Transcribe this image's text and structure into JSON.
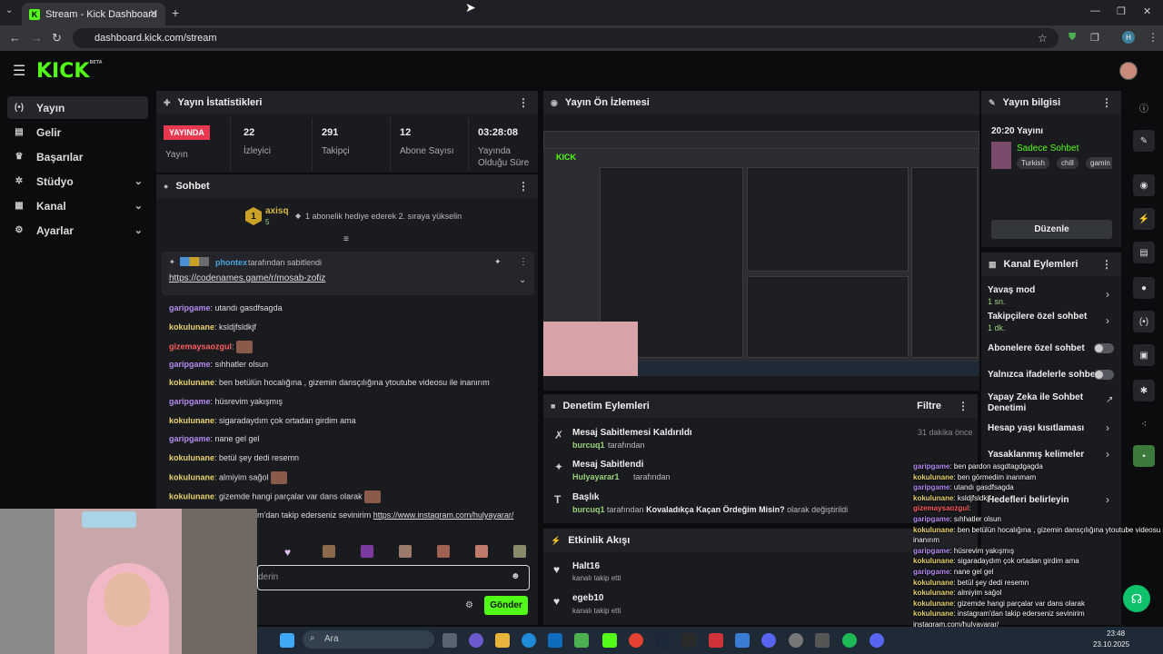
{
  "browser": {
    "tab_title": "Stream - Kick Dashboard",
    "tab_favicon": "K",
    "url": "dashboard.kick.com/stream",
    "profile_initial": "H"
  },
  "brand": {
    "logo": "KICK",
    "logo_sup": "BETA",
    "accent": "#53fc18"
  },
  "sidebar": {
    "items": [
      {
        "label": "Yayın",
        "icon": "broadcast-icon",
        "glyph": "(•)",
        "active": true
      },
      {
        "label": "Gelir",
        "icon": "revenue-icon",
        "glyph": "▤"
      },
      {
        "label": "Başarılar",
        "icon": "trophy-icon",
        "glyph": "♛"
      },
      {
        "label": "Stüdyo",
        "icon": "studio-icon",
        "glyph": "✲"
      },
      {
        "label": "Kanal",
        "icon": "channel-icon",
        "glyph": "▦"
      },
      {
        "label": "Ayarlar",
        "icon": "settings-icon",
        "glyph": "⚙"
      }
    ]
  },
  "stats_panel": {
    "title": "Yayın İstatistikleri",
    "live_badge": "YAYINDA",
    "live_label": "Yayın",
    "stats": [
      {
        "value": "22",
        "label": "İzleyici"
      },
      {
        "value": "291",
        "label": "Takipçi"
      },
      {
        "value": "12",
        "label": "Abone Sayısı"
      },
      {
        "value": "03:28:08",
        "label": "Yayında Olduğu Süre"
      }
    ]
  },
  "chat": {
    "title": "Sohbet",
    "gift_user": "axisq",
    "gift_user_level": "1",
    "gift_user_count": "5",
    "gift_text": "1 abonelik hediye ederek 2. sıraya yükselin",
    "pinned_by_user": "phontex",
    "pinned_by_text": "tarafından sabitlendi",
    "pinned_link": "https://codenames.game/r/mosab-zofiz",
    "messages": [
      {
        "user": "garipgame",
        "color": "purple",
        "text": ": utandı gasdfsagda"
      },
      {
        "user": "kokulunane",
        "color": "yellow",
        "text": ": ksldjfsldkjf"
      },
      {
        "user": "gizemaysaozgul",
        "color": "red",
        "text": ":",
        "emote": true
      },
      {
        "user": "garipgame",
        "color": "purple",
        "text": ": sıhhatler olsun"
      },
      {
        "user": "kokulunane",
        "color": "yellow",
        "text": ": ben betülün hocalığına , gizemin dansçılığına ytoutube videosu ile inanırım"
      },
      {
        "user": "garipgame",
        "color": "purple",
        "text": ": hüsrevim yakışmış"
      },
      {
        "user": "kokulunane",
        "color": "yellow",
        "text": ": sigaradaydım çok ortadan girdim ama"
      },
      {
        "user": "garipgame",
        "color": "purple",
        "text": ": nane gel gel"
      },
      {
        "user": "kokulunane",
        "color": "yellow",
        "text": ": betül şey dedi resemn"
      },
      {
        "user": "kokulunane",
        "color": "yellow",
        "text": ": almiyim sağol",
        "emote": true
      },
      {
        "user": "kokulunane",
        "color": "yellow",
        "text": ": gizemde hangi parçalar var dans olarak",
        "emote": true
      }
    ],
    "partial_message": "m'dan takip ederseniz sevinirim",
    "partial_link": "https://www.instagram.com/hulyayarar/",
    "input_placeholder": "derin",
    "send_label": "Gönder"
  },
  "preview": {
    "title": "Yayın Ön İzlemesi"
  },
  "moderation": {
    "title": "Denetim Eylemleri",
    "filter_label": "Filtre",
    "items": [
      {
        "icon": "unpin-icon",
        "glyph": "✗",
        "title": "Mesaj Sabitlemesi Kaldırıldı",
        "user": "burcuq1",
        "suffix": "tarafından",
        "time": "31 dakika önce"
      },
      {
        "icon": "pin-icon",
        "glyph": "✦",
        "title": "Mesaj Sabitlendi",
        "user": "Hulyayarar1",
        "suffix": "tarafından",
        "time": ""
      },
      {
        "icon": "title-icon",
        "glyph": "T",
        "title": "Başlık",
        "user": "burcuq1",
        "suffix": "tarafından",
        "bold": "Kovaladıkça Kaçan Ördeğim Misin?",
        "end": "olarak değiştirildi",
        "time": ""
      }
    ]
  },
  "activity": {
    "title": "Etkinlik Akışı",
    "items": [
      {
        "user": "Halt16",
        "action": "kanalı takip etti"
      },
      {
        "user": "egeb10",
        "action": "kanalı takip etti"
      }
    ]
  },
  "stream_info": {
    "title": "Yayın bilgisi",
    "stream_title": "20:20 Yayını",
    "category": "Sadece Sohbet",
    "tags": [
      "Turkish",
      "chill",
      "gamin"
    ],
    "edit_label": "Düzenle"
  },
  "channel_actions": {
    "title": "Kanal Eylemleri",
    "items": [
      {
        "label": "Yavaş mod",
        "sub": "1 sn.",
        "type": "chevron"
      },
      {
        "label": "Takipçilere özel sohbet",
        "sub": "1 dk.",
        "type": "chevron"
      },
      {
        "label": "Abonelere özel sohbet",
        "type": "toggle"
      },
      {
        "label": "Yalnızca ifadelerle sohbet",
        "type": "toggle"
      },
      {
        "label": "Yapay Zeka ile Sohbet Denetimi",
        "type": "external"
      },
      {
        "label": "Hesap yaşı kısıtlaması",
        "type": "chevron"
      },
      {
        "label": "Yasaklanmış kelimeler",
        "type": "chevron"
      },
      {
        "label": "Hedefleri belirleyin",
        "type": "chevron"
      }
    ]
  },
  "overlay_chat": [
    {
      "user": "garipgame",
      "color": "purple",
      "text": ": ben pardon asgdtagdgagda"
    },
    {
      "user": "kokulunane",
      "color": "yellow",
      "text": ": ben görmedim inanmam"
    },
    {
      "user": "garipgame",
      "color": "purple",
      "text": ": utandı gasdfsagda"
    },
    {
      "user": "kokulunane",
      "color": "yellow",
      "text": ": ksldjfsldkjf"
    },
    {
      "user": "gizemaysaozgul",
      "color": "red",
      "text": ":"
    },
    {
      "user": "garipgame",
      "color": "purple",
      "text": ": sıhhatler olsun"
    },
    {
      "user": "kokulunane",
      "color": "yellow",
      "text": ": ben betülün hocalığına , gizemin dansçılığına ytoutube videosu ile"
    },
    {
      "user": "",
      "color": "white",
      "text": "inanırım"
    },
    {
      "user": "garipgame",
      "color": "purple",
      "text": ": hüsrevim yakışmış"
    },
    {
      "user": "kokulunane",
      "color": "yellow",
      "text": ": sigaradaydım çok ortadan girdim ama"
    },
    {
      "user": "garipgame",
      "color": "purple",
      "text": ": nane gel gel"
    },
    {
      "user": "kokulunane",
      "color": "yellow",
      "text": ": betül şey dedi resemn"
    },
    {
      "user": "kokulunane",
      "color": "yellow",
      "text": ": almiyim sağol"
    },
    {
      "user": "kokulunane",
      "color": "yellow",
      "text": ": gizemde hangi parçalar var dans olarak"
    },
    {
      "user": "kokulunane",
      "color": "yellow",
      "text": ": instagram'dan takip ederseniz sevinirim"
    },
    {
      "user": "",
      "color": "white",
      "text": "instagram.com/hulyayarar/"
    }
  ],
  "taskbar": {
    "search_placeholder": "Ara",
    "time": "23:48",
    "date": "23.10.2025"
  }
}
